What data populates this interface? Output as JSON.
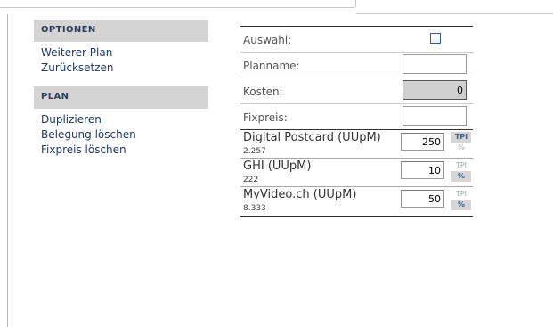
{
  "sidebar": {
    "sections": [
      {
        "title": "OPTIONEN",
        "links": [
          "Weiterer Plan",
          "Zurücksetzen"
        ]
      },
      {
        "title": "PLAN",
        "links": [
          "Duplizieren",
          "Belegung löschen",
          "Fixpreis löschen"
        ]
      }
    ]
  },
  "form": {
    "auswahl_label": "Auswahl:",
    "planname_label": "Planname:",
    "planname_value": "",
    "kosten_label": "Kosten:",
    "kosten_value": "0",
    "fixpreis_label": "Fixpreis:",
    "fixpreis_value": ""
  },
  "items": [
    {
      "name": "Digital Postcard (UUpM)",
      "sub": "2.257",
      "value": "250",
      "tpi": "TPI",
      "pct": "%",
      "active": "tpi"
    },
    {
      "name": "GHI (UUpM)",
      "sub": "222",
      "value": "10",
      "tpi": "TPI",
      "pct": "%",
      "active": "pct"
    },
    {
      "name": "MyVideo.ch (UUpM)",
      "sub": "8.333",
      "value": "50",
      "tpi": "TPI",
      "pct": "%",
      "active": "pct"
    }
  ]
}
